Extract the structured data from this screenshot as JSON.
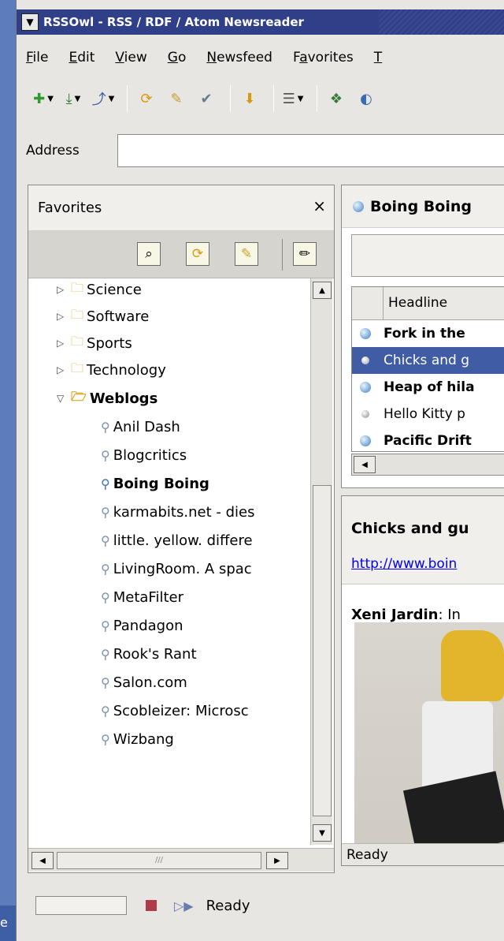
{
  "desktop": {
    "label": "e"
  },
  "window": {
    "title": "RSSOwl - RSS / RDF / Atom Newsreader",
    "menu": [
      {
        "label": "File",
        "accel": "F",
        "rest": "ile"
      },
      {
        "label": "Edit",
        "accel": "E",
        "rest": "dit"
      },
      {
        "label": "View",
        "accel": "V",
        "rest": "iew"
      },
      {
        "label": "Go",
        "accel": "G",
        "rest": "o"
      },
      {
        "label": "Newsfeed",
        "accel": "N",
        "rest": "ewsfeed"
      },
      {
        "label": "Favorites",
        "pre": "F",
        "accel": "a",
        "rest": "vorites"
      },
      {
        "label": "T",
        "accel": "T",
        "rest": ""
      }
    ],
    "toolbar_icons": [
      "new-icon",
      "import-icon",
      "export-icon",
      "reload-icon",
      "search-icon",
      "mark-read-icon",
      "download-icon",
      "view-options-icon",
      "favorite-icon",
      "web-icon"
    ],
    "address": {
      "label": "Address",
      "value": ""
    }
  },
  "favorites": {
    "title": "Favorites",
    "close": "×",
    "tools": [
      "find-icon",
      "reload-all-icon",
      "aggregate-icon",
      "edit-icon"
    ],
    "tree": [
      {
        "label": "Science",
        "type": "folder",
        "expanded": false
      },
      {
        "label": "Software",
        "type": "folder",
        "expanded": false
      },
      {
        "label": "Sports",
        "type": "folder",
        "expanded": false
      },
      {
        "label": "Technology",
        "type": "folder",
        "expanded": false
      },
      {
        "label": "Weblogs",
        "type": "folder",
        "expanded": true
      },
      {
        "label": "Anil Dash",
        "type": "feed"
      },
      {
        "label": "Blogcritics",
        "type": "feed"
      },
      {
        "label": "Boing Boing",
        "type": "feed",
        "active": true
      },
      {
        "label": "karmabits.net - dies",
        "type": "feed"
      },
      {
        "label": "little. yellow. differe",
        "type": "feed"
      },
      {
        "label": "LivingRoom. A spac",
        "type": "feed"
      },
      {
        "label": "MetaFilter",
        "type": "feed"
      },
      {
        "label": "Pandagon",
        "type": "feed"
      },
      {
        "label": "Rook's Rant",
        "type": "feed"
      },
      {
        "label": "Salon.com",
        "type": "feed"
      },
      {
        "label": "Scobleizer: Microsc",
        "type": "feed"
      },
      {
        "label": "Wizbang",
        "type": "feed"
      }
    ]
  },
  "feed": {
    "tab_title": "Boing Boing",
    "column_headline": "Headline",
    "rows": [
      {
        "text": "Fork in the",
        "unread": true,
        "selected": false
      },
      {
        "text": "Chicks and g",
        "unread": false,
        "selected": true
      },
      {
        "text": "Heap of hila",
        "unread": true,
        "selected": false
      },
      {
        "text": "Hello Kitty p",
        "unread": false,
        "selected": false
      },
      {
        "text": "Pacific Drift",
        "unread": true,
        "selected": false
      }
    ]
  },
  "preview": {
    "title": "Chicks and gu",
    "link": "http://www.boin",
    "author": "Xeni Jardin",
    "intro": ": In",
    "status": "Ready"
  },
  "statusbar": {
    "text": "Ready"
  },
  "colors": {
    "titlebar": "#2f3f88",
    "selection": "#3f5ca5",
    "folder": "#d99b14"
  }
}
